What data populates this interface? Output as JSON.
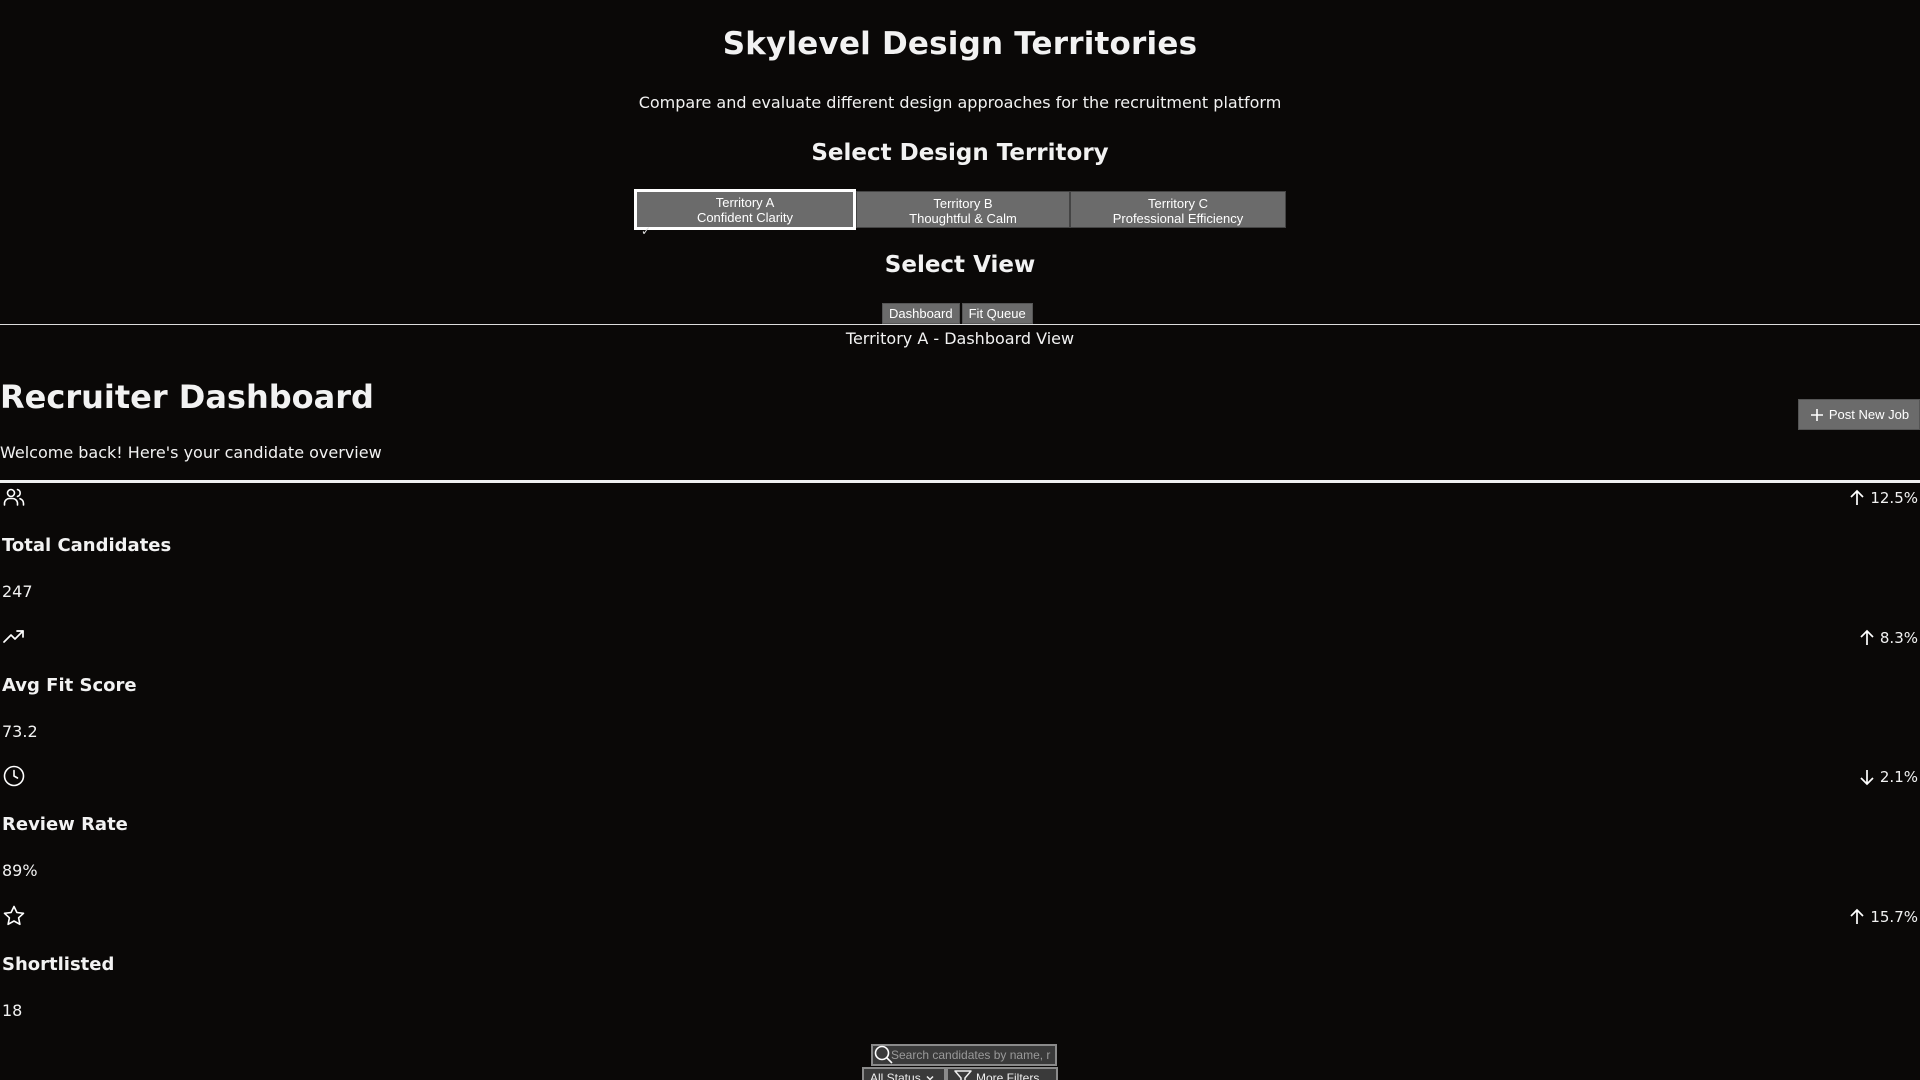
{
  "header": {
    "title": "Skylevel Design Territories",
    "subtitle": "Compare and evaluate different design approaches for the recruitment platform"
  },
  "territory_section": {
    "heading": "Select Design Territory",
    "options": [
      {
        "name": "Territory A",
        "desc": "Confident Clarity",
        "selected": true
      },
      {
        "name": "Territory B",
        "desc": "Thoughtful & Calm",
        "selected": false
      },
      {
        "name": "Territory C",
        "desc": "Professional Efficiency",
        "selected": false
      }
    ],
    "check": "✓"
  },
  "view_section": {
    "heading": "Select View",
    "tabs": [
      "Dashboard",
      "Fit Queue"
    ],
    "caption": "Territory A - Dashboard View"
  },
  "dashboard": {
    "title": "Recruiter Dashboard",
    "subtitle": "Welcome back! Here's your candidate overview",
    "post_button": "Post New Job",
    "stats": [
      {
        "icon": "users-icon",
        "label": "Total Candidates",
        "value": "247",
        "change": "12.5%",
        "direction": "up"
      },
      {
        "icon": "trending-up-icon",
        "label": "Avg Fit Score",
        "value": "73.2",
        "change": "8.3%",
        "direction": "up"
      },
      {
        "icon": "clock-icon",
        "label": "Review Rate",
        "value": "89%",
        "change": "2.1%",
        "direction": "down"
      },
      {
        "icon": "star-icon",
        "label": "Shortlisted",
        "value": "18",
        "change": "15.7%",
        "direction": "up"
      }
    ]
  },
  "filters": {
    "search_placeholder": "Search candidates by name, r",
    "status_label": "All Status",
    "more_filters_label": "More Filters"
  }
}
